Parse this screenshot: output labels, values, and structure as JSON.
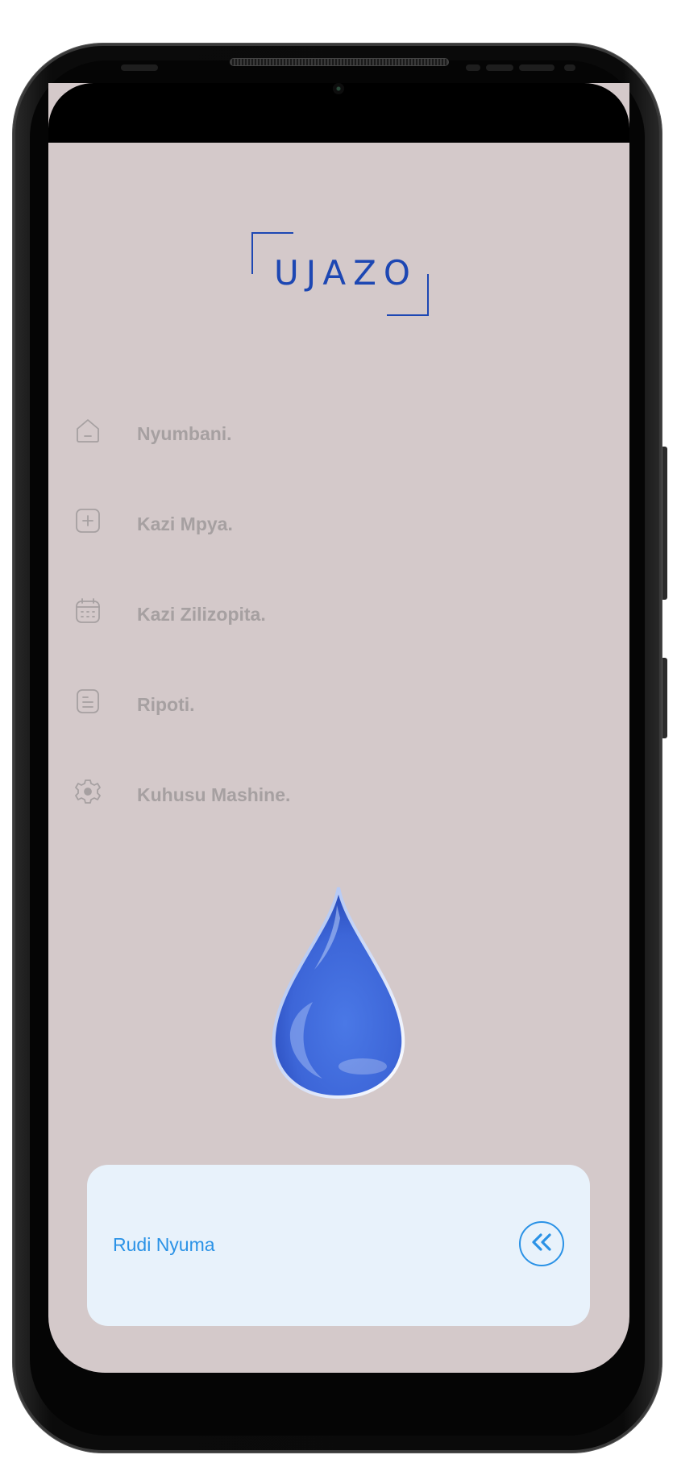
{
  "app": {
    "logo_text": "UJAZO"
  },
  "menu": {
    "items": [
      {
        "label": "Nyumbani.",
        "icon": "home-icon"
      },
      {
        "label": "Kazi Mpya.",
        "icon": "plus-square-icon"
      },
      {
        "label": "Kazi Zilizopita.",
        "icon": "calendar-icon"
      },
      {
        "label": "Ripoti.",
        "icon": "document-icon"
      },
      {
        "label": "Kuhusu Mashine.",
        "icon": "gear-icon"
      }
    ]
  },
  "illustration": {
    "icon": "water-drop-icon"
  },
  "footer": {
    "back_label": "Rudi Nyuma",
    "back_icon": "double-chevron-left-icon"
  },
  "colors": {
    "screen_bg": "#d4c9ca",
    "brand_blue": "#1d47b3",
    "accent_blue": "#2a92e6",
    "menu_text": "#a6a0a1",
    "card_bg": "#e8f2fb"
  }
}
